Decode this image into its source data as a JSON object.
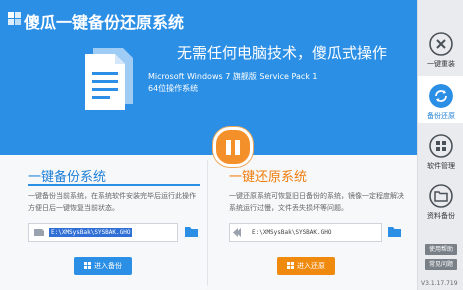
{
  "app": {
    "title": "傻瓜一键备份还原系统"
  },
  "banner": {
    "slogan": "无需任何电脑技术，傻瓜式操作",
    "os_line1": "Microsoft Windows 7 旗舰版 Service Pack 1",
    "os_line2": "64位操作系统"
  },
  "sidebar": {
    "items": [
      {
        "label": "一键重装",
        "icon": "close-x-icon"
      },
      {
        "label": "备份还原",
        "icon": "sync-icon"
      },
      {
        "label": "软件管理",
        "icon": "grid-icon"
      },
      {
        "label": "资料备份",
        "icon": "folder-icon"
      }
    ],
    "buttons": {
      "help": "使用帮助",
      "faq": "常见问题"
    },
    "version": "V3.1.17.719"
  },
  "backup": {
    "title": "一键备份系统",
    "desc": "一键备份当前系统，在系统软件安装完毕后运行此操作方便日后一键恢复当前状态。",
    "path": "E:\\XMSysBak\\SYSBAK.GHO",
    "button": "进入备份"
  },
  "restore": {
    "title": "一键还原系统",
    "desc": "一键还原系统可恢复旧日备份的系统，镜像一定程度解决系统运行过慢，文件丢失损坏等问题。",
    "path": "E:\\XMSysBak\\SYSBAK.GHO",
    "button": "进入还原"
  },
  "colors": {
    "banner": "#2b8fe6",
    "accent_blue": "#1e7fd6",
    "accent_orange": "#ef7d0c"
  }
}
